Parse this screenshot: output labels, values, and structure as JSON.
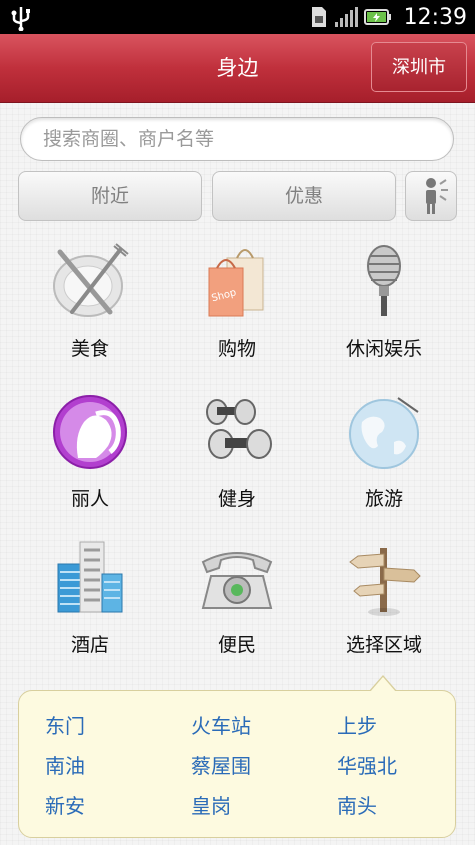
{
  "status_bar": {
    "time": "12:39",
    "icons": [
      "usb-icon",
      "sim-card-icon",
      "signal-icon",
      "battery-charging-icon"
    ]
  },
  "header": {
    "title": "身边",
    "city_button": "深圳市"
  },
  "search": {
    "placeholder": "搜索商圈、商户名等"
  },
  "buttons": {
    "nearby": "附近",
    "deals": "优惠",
    "shake_icon": "shake-person-icon"
  },
  "categories": [
    {
      "label": "美食",
      "icon": "plate-fork-knife-icon"
    },
    {
      "label": "购物",
      "icon": "shopping-bag-icon"
    },
    {
      "label": "休闲娱乐",
      "icon": "microphone-icon"
    },
    {
      "label": "丽人",
      "icon": "woman-silhouette-icon"
    },
    {
      "label": "健身",
      "icon": "dumbbell-icon"
    },
    {
      "label": "旅游",
      "icon": "globe-icon"
    },
    {
      "label": "酒店",
      "icon": "hotel-building-icon"
    },
    {
      "label": "便民",
      "icon": "telephone-icon"
    },
    {
      "label": "选择区域",
      "icon": "signpost-icon"
    }
  ],
  "districts": [
    "东门",
    "火车站",
    "上步",
    "南油",
    "蔡屋围",
    "华强北",
    "新安",
    "皇岗",
    "南头"
  ],
  "colors": {
    "header_red": "#c0303c",
    "district_link": "#2a6bb8",
    "panel_bg": "#fdfae0"
  }
}
